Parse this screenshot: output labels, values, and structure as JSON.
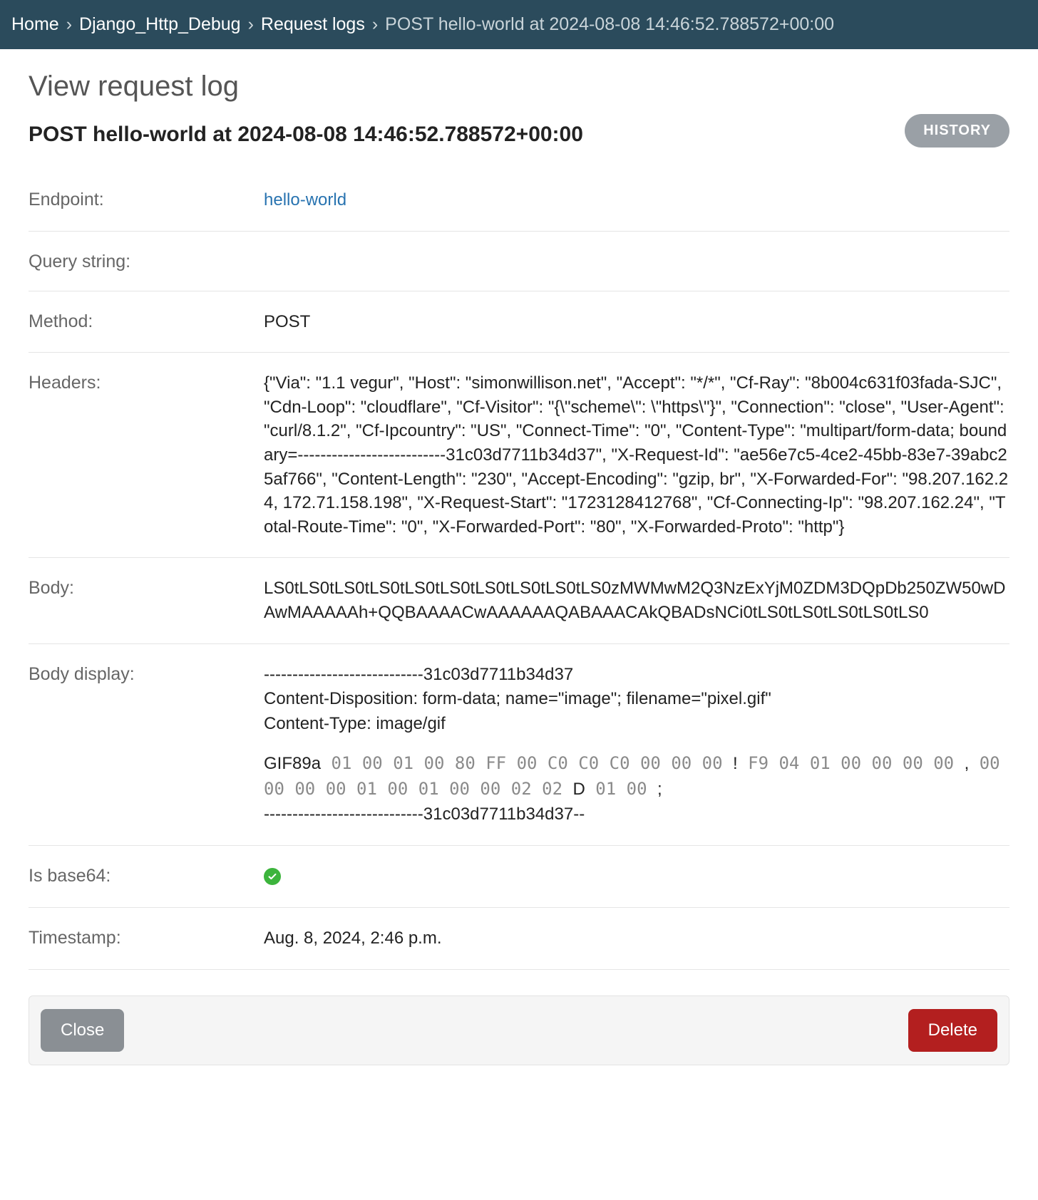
{
  "breadcrumbs": {
    "sep": "›",
    "items": [
      "Home",
      "Django_Http_Debug",
      "Request logs"
    ],
    "current": "POST hello-world at 2024-08-08 14:46:52.788572+00:00"
  },
  "view_title": "View request log",
  "history_label": "HISTORY",
  "object_title": "POST hello-world at 2024-08-08 14:46:52.788572+00:00",
  "fields": {
    "endpoint": {
      "label": "Endpoint:",
      "link_text": "hello-world"
    },
    "query_string": {
      "label": "Query string:",
      "value": ""
    },
    "method": {
      "label": "Method:",
      "value": "POST"
    },
    "headers": {
      "label": "Headers:",
      "value": "{\"Via\": \"1.1 vegur\", \"Host\": \"simonwillison.net\", \"Accept\": \"*/*\", \"Cf-Ray\": \"8b004c631f03fada-SJC\", \"Cdn-Loop\": \"cloudflare\", \"Cf-Visitor\": \"{\\\"scheme\\\": \\\"https\\\"}\", \"Connection\": \"close\", \"User-Agent\": \"curl/8.1.2\", \"Cf-Ipcountry\": \"US\", \"Connect-Time\": \"0\", \"Content-Type\": \"multipart/form-data; boundary=--------------------------31c03d7711b34d37\", \"X-Request-Id\": \"ae56e7c5-4ce2-45bb-83e7-39abc25af766\", \"Content-Length\": \"230\", \"Accept-Encoding\": \"gzip, br\", \"X-Forwarded-For\": \"98.207.162.24, 172.71.158.198\", \"X-Request-Start\": \"1723128412768\", \"Cf-Connecting-Ip\": \"98.207.162.24\", \"Total-Route-Time\": \"0\", \"X-Forwarded-Port\": \"80\", \"X-Forwarded-Proto\": \"http\"}"
    },
    "body": {
      "label": "Body:",
      "value": "LS0tLS0tLS0tLS0tLS0tLS0tLS0tLS0tLS0tLS0zMWMwM2Q3NzExYjM0ZDM3DQpDb250ZW50wDAwMAAAAAh+QQBAAAACwAAAAAAQABAAACAkQBADsNCi0tLS0tLS0tLS0tLS0tLS0"
    },
    "body_display": {
      "label": "Body display:",
      "pre_text": "----------------------------31c03d7711b34d37\nContent-Disposition: form-data; name=\"image\"; filename=\"pixel.gif\"\nContent-Type: image/gif",
      "segments": [
        {
          "t": "ascii",
          "v": "GIF89a"
        },
        {
          "t": "hex",
          "v": " 01 00 01 00 80 FF 00 C0 C0 C0 00 00 00 "
        },
        {
          "t": "ascii",
          "v": "!"
        },
        {
          "t": "hex",
          "v": " F9 04 01 00 00 00 00 "
        },
        {
          "t": "ascii",
          "v": ","
        },
        {
          "t": "hex",
          "v": " 00 00 00 00 01 00 01 00 00 02 02 "
        },
        {
          "t": "ascii",
          "v": "D"
        },
        {
          "t": "hex",
          "v": " 01 00 "
        },
        {
          "t": "ascii",
          "v": ";"
        }
      ],
      "post_text": "----------------------------31c03d7711b34d37--"
    },
    "is_base64": {
      "label": "Is base64:",
      "checked": true
    },
    "timestamp": {
      "label": "Timestamp:",
      "value": "Aug. 8, 2024, 2:46 p.m."
    }
  },
  "footer": {
    "close_label": "Close",
    "delete_label": "Delete"
  }
}
